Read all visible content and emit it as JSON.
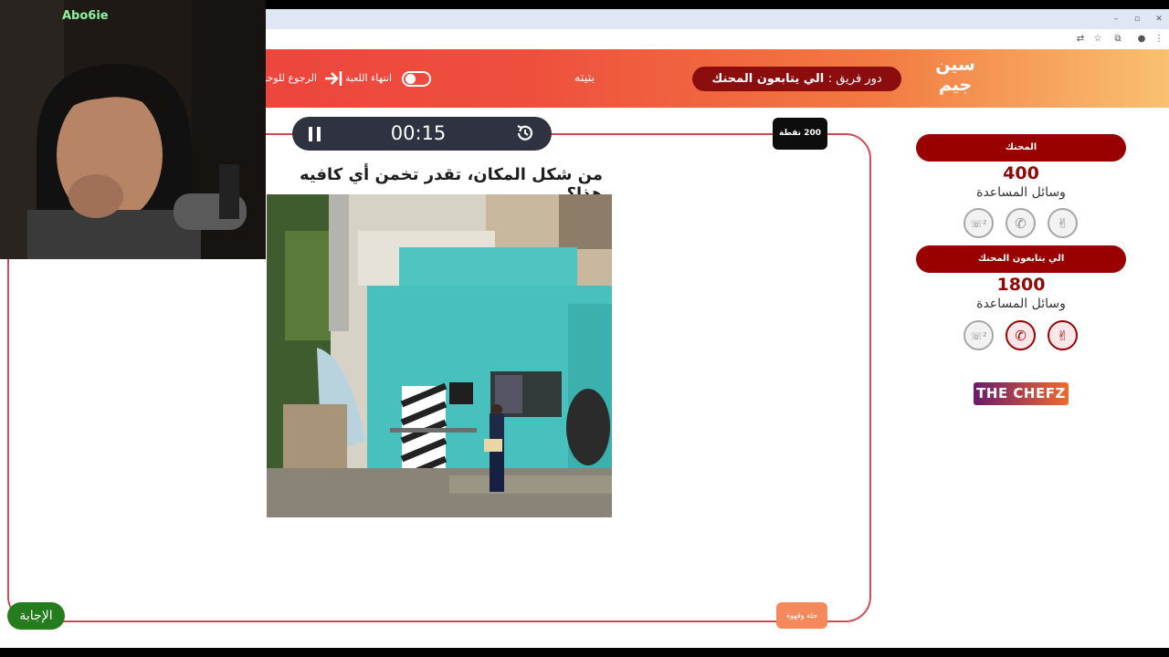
{
  "browser": {
    "window_controls": [
      "–",
      "▫",
      "✕"
    ]
  },
  "header": {
    "logo_text_top": "سين",
    "logo_text_bottom": "جيم",
    "team_turn_prefix": "دور فريق :",
    "team_turn_name": "الي يتابعون المحنك",
    "center_label": "بتيته",
    "end_game_label": "انتهاء اللعبة",
    "back_label": "الرجوع للوحة"
  },
  "timer": {
    "time": "00:15"
  },
  "points_badge": "200 نقطة",
  "question": "من شكل المكان، تقدر تخمن أي كافيه هذا؟",
  "hint_button": "جلة وقهوة",
  "answer_button": "الإجابة",
  "webcam": {
    "overlay_text": "Abo6ie"
  },
  "teams": [
    {
      "name": "المحنك",
      "score": "400",
      "aids_label": "وسائل المساعدة",
      "aids": [
        {
          "icon": "two-answers-icon",
          "used": false
        },
        {
          "icon": "phone-icon",
          "used": false
        },
        {
          "icon": "peace-hand-icon",
          "used": false
        }
      ]
    },
    {
      "name": "الي يتابعون المحنك",
      "score": "1800",
      "aids_label": "وسائل المساعدة",
      "aids": [
        {
          "icon": "two-answers-icon",
          "used": false
        },
        {
          "icon": "phone-icon",
          "used": true
        },
        {
          "icon": "peace-hand-icon",
          "used": true
        }
      ]
    }
  ],
  "brand": "THE CHEFZ",
  "colors": {
    "header_red": "#ec3c3d",
    "team_red": "#990000",
    "answer_green": "#257c1c",
    "hint_orange": "#f48a5c",
    "frame_border": "#d04a56"
  }
}
